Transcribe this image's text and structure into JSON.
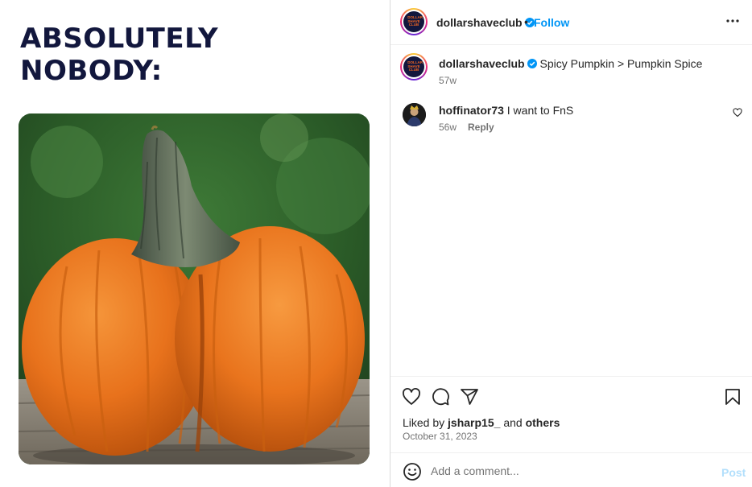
{
  "post": {
    "media": {
      "headline": [
        "ABSOLUTELY",
        "NOBODY:"
      ]
    },
    "header": {
      "username": "dollarshaveclub",
      "separator": "•",
      "follow_label": "Follow",
      "avatar_text": "DOLLAR SHAVE CLUB",
      "icons": {
        "verified": "verified-badge-icon",
        "more": "more-options-icon"
      }
    },
    "caption": {
      "username": "dollarshaveclub",
      "text": "Spicy Pumpkin > Pumpkin Spice",
      "time": "57w"
    },
    "comments": [
      {
        "username": "hoffinator73",
        "text": "I want to FnS",
        "time": "56w",
        "reply_label": "Reply"
      }
    ],
    "actions": {
      "icons": [
        "heart-icon",
        "comment-icon",
        "share-icon",
        "save-icon"
      ],
      "liked_by_prefix": "Liked by",
      "liked_by_user": "jsharp15_",
      "liked_by_and": "and",
      "liked_by_others": "others",
      "date": "October 31, 2023"
    },
    "composer": {
      "placeholder": "Add a comment...",
      "post_label": "Post"
    },
    "colors": {
      "accent": "#0095f6",
      "text": "#262626",
      "muted": "#737373",
      "headline": "#12173d",
      "pumpkin": "#e8721c"
    }
  }
}
